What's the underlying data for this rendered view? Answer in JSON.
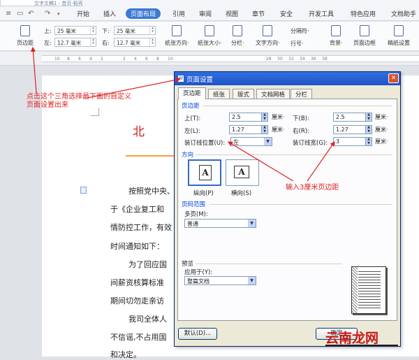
{
  "app": {
    "doc_tab_title": "文字文稿1 - 首页·稻壳",
    "menus": [
      "开始",
      "插入",
      "页面布局",
      "引用",
      "审阅",
      "视图",
      "章节",
      "安全",
      "开发工具",
      "特色应用",
      "文档助手"
    ],
    "active_menu": "页面布局"
  },
  "ribbon": {
    "margin_button": "页边距",
    "margins": {
      "top_label": "上:",
      "top": "25 毫米",
      "bottom_label": "下:",
      "bottom": "25 毫米",
      "left_label": "左:",
      "left": "12.7 毫米",
      "right_label": "右:",
      "right": "12.7 毫米"
    },
    "orientation": "纸张方向·",
    "size": "纸张大小·",
    "columns": "分栏·",
    "text_direction": "文字方向·",
    "separator": "分隔符·",
    "line_number": "行号·",
    "background": "背景·",
    "page_border": "页面边框",
    "paper_setting": "稿纸设置"
  },
  "ruler": {
    "numbers": [
      "10",
      "8",
      "6",
      "4",
      "2",
      "2",
      "4",
      "6",
      "8",
      "10",
      "12",
      "14",
      "16",
      "18",
      "20",
      "22",
      "24",
      "26",
      "28",
      "30",
      "32",
      "34",
      "36",
      "38"
    ]
  },
  "document": {
    "title": "北 京",
    "paragraphs": [
      "按照党中央、",
      "于《企业复工和",
      "情防控工作，有效",
      "时间通知如下：",
      "为了回应国",
      "间薪资核算标准",
      "期间切勿走亲访",
      "我司全体人",
      "不信谣,不占用国",
      "和决定。"
    ]
  },
  "annotations": {
    "left": [
      "点击这个三角选择最下面的自定义",
      "页面设置出来"
    ],
    "right": "输入3厘米页边距"
  },
  "dialog": {
    "title": "页面设置",
    "tabs": [
      "页边距",
      "纸张",
      "版式",
      "文档网格",
      "分栏"
    ],
    "active_tab": "页边距",
    "margins_group": "页边距",
    "top_label": "上(T):",
    "top": "2.5",
    "bottom_label": "下(B):",
    "bottom": "2.5",
    "left_label": "左(L):",
    "left": "1.27",
    "right_label": "右(R):",
    "right": "1.27",
    "unit": "厘米·",
    "gutter_pos_label": "装订线位置(U):",
    "gutter_pos": "左",
    "gutter_width_label": "装订线宽(G):",
    "gutter_width": "3",
    "orientation_group": "方向",
    "portrait": "纵向(P)",
    "landscape": "横向(S)",
    "page_range_group": "页码范围",
    "multi_page_label": "多页(M):",
    "multi_page": "普通",
    "preview_group": "预览",
    "apply_to_label": "应用于(Y):",
    "apply_to": "整篇文档",
    "default_button": "默认(D)...",
    "ok_button": "确定"
  },
  "watermark": "云南龙网",
  "colors": {
    "accent": "#3a79d3",
    "annotation": "#e02020",
    "title_red": "#d21d1d"
  }
}
